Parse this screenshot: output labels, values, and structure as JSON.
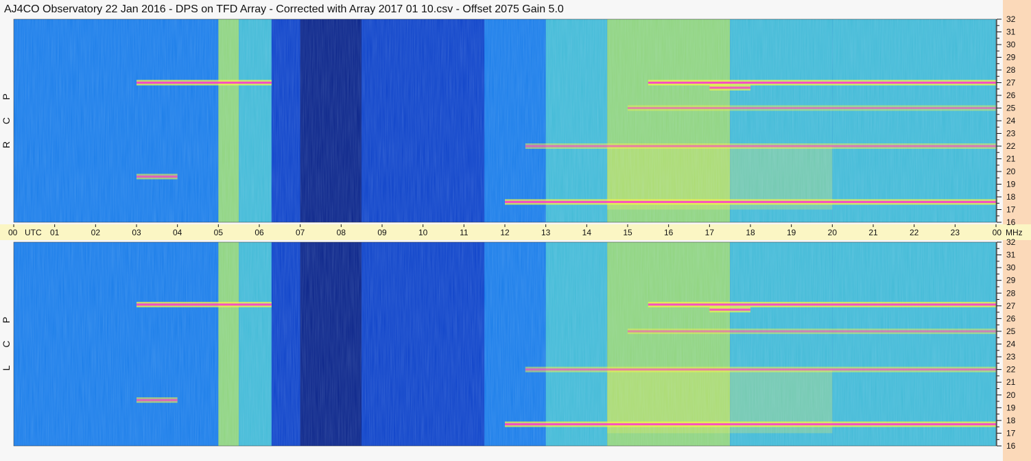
{
  "title": "AJ4CO Observatory  22 Jan 2016  -  DPS on TFD Array  -  Corrected with Array 2017 01 10.csv  -  Offset 2075  Gain 5.0",
  "time_axis": {
    "label": "UTC",
    "ticks": [
      "00",
      "01",
      "02",
      "03",
      "04",
      "05",
      "06",
      "07",
      "08",
      "09",
      "10",
      "11",
      "12",
      "13",
      "14",
      "15",
      "16",
      "17",
      "18",
      "19",
      "20",
      "21",
      "22",
      "23",
      "00"
    ],
    "unit": "MHz"
  },
  "panels": [
    {
      "polarization": [
        "R",
        "C",
        "P"
      ],
      "freq_ticks": [
        "32",
        "31",
        "30",
        "29",
        "28",
        "27",
        "26",
        "25",
        "24",
        "23",
        "22",
        "21",
        "20",
        "19",
        "18",
        "17",
        "16"
      ]
    },
    {
      "polarization": [
        "L",
        "C",
        "P"
      ],
      "freq_ticks": [
        "32",
        "31",
        "30",
        "29",
        "28",
        "27",
        "26",
        "25",
        "24",
        "23",
        "22",
        "21",
        "20",
        "19",
        "18",
        "17",
        "16"
      ]
    }
  ],
  "colors": {
    "background": "#0a3fc8",
    "quiet_night": "#061a7a",
    "moderate": "#1a86ee",
    "active": "#4ad0d8",
    "bright": "#a8f070",
    "burst_yellow": "#f4f24a",
    "burst_magenta": "#ff2ad8",
    "time_bar": "#fbf6c4",
    "freq_strip": "#fbd9b9"
  },
  "chart_data": {
    "type": "heatmap",
    "title": "AJ4CO Observatory  22 Jan 2016  -  DPS on TFD Array  -  Corrected with Array 2017 01 10.csv  -  Offset 2075  Gain 5.0",
    "xlabel": "UTC",
    "ylabel": "MHz",
    "xlim": [
      0,
      24
    ],
    "ylim": [
      16,
      32
    ],
    "series": [
      {
        "name": "RCP",
        "time_blocks": [
          {
            "start": 0,
            "end": 3,
            "level": 0.35
          },
          {
            "start": 3,
            "end": 5,
            "level": 0.45
          },
          {
            "start": 5,
            "end": 5.5,
            "level": 0.75
          },
          {
            "start": 5.5,
            "end": 6.3,
            "level": 0.55
          },
          {
            "start": 6.3,
            "end": 7,
            "level": 0.2
          },
          {
            "start": 7,
            "end": 8.5,
            "level": 0.05
          },
          {
            "start": 8.5,
            "end": 9.5,
            "level": 0.15
          },
          {
            "start": 9.5,
            "end": 11.5,
            "level": 0.25
          },
          {
            "start": 11.5,
            "end": 13,
            "level": 0.45
          },
          {
            "start": 13,
            "end": 14.5,
            "level": 0.55
          },
          {
            "start": 14.5,
            "end": 17.5,
            "level": 0.75
          },
          {
            "start": 17.5,
            "end": 20,
            "level": 0.65
          },
          {
            "start": 20,
            "end": 24,
            "level": 0.55
          }
        ],
        "emission_lines": [
          {
            "freq": 27,
            "start": 3,
            "end": 6.3,
            "intensity": 1.0
          },
          {
            "freq": 27,
            "start": 15.5,
            "end": 24,
            "intensity": 1.0
          },
          {
            "freq": 26.6,
            "start": 17,
            "end": 18,
            "intensity": 0.9
          },
          {
            "freq": 17.6,
            "start": 12,
            "end": 24,
            "intensity": 1.0
          },
          {
            "freq": 19.6,
            "start": 3,
            "end": 4,
            "intensity": 0.8
          },
          {
            "freq": 22,
            "start": 12.5,
            "end": 24,
            "intensity": 0.7
          },
          {
            "freq": 25,
            "start": 15,
            "end": 24,
            "intensity": 0.6
          }
        ]
      },
      {
        "name": "LCP",
        "time_blocks": [
          {
            "start": 0,
            "end": 3,
            "level": 0.35
          },
          {
            "start": 3,
            "end": 5,
            "level": 0.45
          },
          {
            "start": 5,
            "end": 5.5,
            "level": 0.75
          },
          {
            "start": 5.5,
            "end": 6.3,
            "level": 0.55
          },
          {
            "start": 6.3,
            "end": 7,
            "level": 0.2
          },
          {
            "start": 7,
            "end": 8.5,
            "level": 0.05
          },
          {
            "start": 8.5,
            "end": 9.5,
            "level": 0.15
          },
          {
            "start": 9.5,
            "end": 11.5,
            "level": 0.25
          },
          {
            "start": 11.5,
            "end": 13,
            "level": 0.45
          },
          {
            "start": 13,
            "end": 14.5,
            "level": 0.55
          },
          {
            "start": 14.5,
            "end": 17.5,
            "level": 0.75
          },
          {
            "start": 17.5,
            "end": 20,
            "level": 0.65
          },
          {
            "start": 20,
            "end": 24,
            "level": 0.55
          }
        ],
        "emission_lines": [
          {
            "freq": 27.1,
            "start": 3,
            "end": 6.3,
            "intensity": 1.0
          },
          {
            "freq": 27.1,
            "start": 15.5,
            "end": 24,
            "intensity": 1.0
          },
          {
            "freq": 26.7,
            "start": 17,
            "end": 18,
            "intensity": 0.9
          },
          {
            "freq": 17.7,
            "start": 12,
            "end": 24,
            "intensity": 1.0
          },
          {
            "freq": 19.6,
            "start": 3,
            "end": 4,
            "intensity": 0.8
          },
          {
            "freq": 22,
            "start": 12.5,
            "end": 24,
            "intensity": 0.7
          },
          {
            "freq": 25,
            "start": 15,
            "end": 24,
            "intensity": 0.6
          }
        ]
      }
    ]
  }
}
